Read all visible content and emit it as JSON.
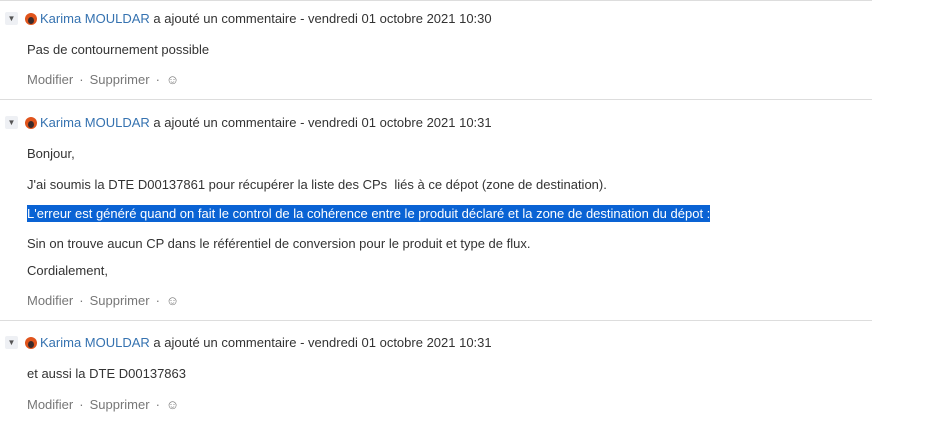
{
  "comments": [
    {
      "author": "Karima MOULDAR",
      "action": " a ajouté un commentaire - vendredi 01 octobre 2021 10:30",
      "lines": [
        "Pas de contournement possible"
      ]
    },
    {
      "author": "Karima MOULDAR",
      "action": " a ajouté un commentaire - vendredi 01 octobre 2021 10:31",
      "lines": [
        "Bonjour,",
        "J'ai soumis la DTE D00137861 pour récupérer la liste des CPs  liés à ce dépot (zone de destination).",
        "L'erreur est généré quand on fait le control de la cohérence entre le produit déclaré et la zone de destination du dépot :",
        "Sin on trouve aucun CP dans le référentiel de conversion pour le produit et type de flux.",
        "Cordialement,"
      ]
    },
    {
      "author": "Karima MOULDAR",
      "action": " a ajouté un commentaire - vendredi 01 octobre 2021 10:31",
      "lines": [
        "et aussi la DTE D00137863"
      ]
    }
  ],
  "actions": {
    "edit": "Modifier",
    "delete": "Supprimer",
    "separator": "·",
    "reaction_icon": "smiley-add-icon"
  },
  "colors": {
    "link": "#3572b0",
    "selection": "#0a63d4"
  }
}
